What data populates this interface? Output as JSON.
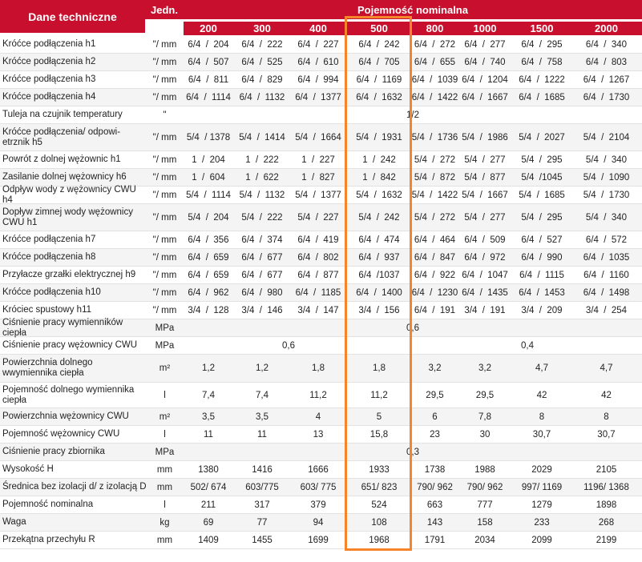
{
  "header": {
    "label": "Dane techniczne",
    "unit": "Jedn.",
    "group": "Pojemność nominalna",
    "capacities": [
      "200",
      "300",
      "400",
      "500",
      "800",
      "1000",
      "1500",
      "2000"
    ]
  },
  "rows": [
    {
      "label": "Króćce podłączenia h1",
      "unit": "\"/ mm",
      "values": [
        "6/4  /  204",
        "6/4  /  222",
        "6/4  /  227",
        "6/4  /  242",
        "6/4  /  272",
        "6/4  /  277",
        "6/4  /  295",
        "6/4  /  340"
      ]
    },
    {
      "label": "Króćce podłączenia h2",
      "unit": "\"/ mm",
      "values": [
        "6/4  /  507",
        "6/4  /  525",
        "6/4  /  610",
        "6/4  /  705",
        "6/4  /  655",
        "6/4  /  740",
        "6/4  /  758",
        "6/4  /  803"
      ]
    },
    {
      "label": "Króćce podłączenia h3",
      "unit": "\"/ mm",
      "values": [
        "6/4  /  811",
        "6/4  /  829",
        "6/4  /  994",
        "6/4  /  1169",
        "6/4  /  1039",
        "6/4  /  1204",
        "6/4  /  1222",
        "6/4  /  1267"
      ]
    },
    {
      "label": "Króćce podłączenia h4",
      "unit": "\"/ mm",
      "values": [
        "6/4  /  1114",
        "6/4  /  1132",
        "6/4  /  1377",
        "6/4  /  1632",
        "6/4  /  1422",
        "6/4  /  1667",
        "6/4  /  1685",
        "6/4  /  1730"
      ]
    },
    {
      "label": "Tuleja na czujnik temperatury",
      "unit": "\"",
      "span": "1/2"
    },
    {
      "label": "Króćce podłączenia/ odpowi-etrznik h5",
      "unit": "\"/ mm",
      "tall": true,
      "values": [
        "5/4  / 1378",
        "5/4  /  1414",
        "5/4  /  1664",
        "5/4  /  1931",
        "5/4  /  1736",
        "5/4  /  1986",
        "5/4  /  2027",
        "5/4  /  2104"
      ]
    },
    {
      "label": "Powrót z dolnej wężownic h1",
      "unit": "\"/ mm",
      "values": [
        "1  /  204",
        "1  /  222",
        "1  /  227",
        "1  /  242",
        "5/4  /  272",
        "5/4  /  277",
        "5/4  /  295",
        "5/4  /  340"
      ]
    },
    {
      "label": "Zasilanie dolnej wężownicy h6",
      "unit": "\"/ mm",
      "values": [
        "1  /  604",
        "1  /  622",
        "1  /  827",
        "1  /  842",
        "5/4  /  872",
        "5/4  /  877",
        "5/4  /1045",
        "5/4  /  1090"
      ]
    },
    {
      "label": "Odpływ wody z wężownicy CWU h4",
      "unit": "\"/ mm",
      "values": [
        "5/4  /  1114",
        "5/4  /  1132",
        "5/4  /  1377",
        "5/4  /  1632",
        "5/4  /  1422",
        "5/4  /  1667",
        "5/4  /  1685",
        "5/4  /  1730"
      ]
    },
    {
      "label": "Dopływ zimnej wody wężownicy CWU h1",
      "unit": "\"/ mm",
      "tall": true,
      "values": [
        "5/4  /  204",
        "5/4  /  222",
        "5/4  /  227",
        "5/4  /  242",
        "5/4  /  272",
        "5/4  /  277",
        "5/4  /  295",
        "5/4  /  340"
      ]
    },
    {
      "label": "Króćce podłączenia h7",
      "unit": "\"/ mm",
      "values": [
        "6/4  /  356",
        "6/4  /  374",
        "6/4  /  419",
        "6/4  /  474",
        "6/4  /  464",
        "6/4  /  509",
        "6/4  /  527",
        "6/4  /  572"
      ]
    },
    {
      "label": "Króćce podłączenia h8",
      "unit": "\"/ mm",
      "values": [
        "6/4  /  659",
        "6/4  /  677",
        "6/4  /  802",
        "6/4  /  937",
        "6/4  /  847",
        "6/4  /  972",
        "6/4  /  990",
        "6/4  /  1035"
      ]
    },
    {
      "label": "Przyłacze grzałki elektrycznej h9",
      "unit": "\"/ mm",
      "values": [
        "6/4  /  659",
        "6/4  /  677",
        "6/4  /  877",
        "6/4  /1037",
        "6/4  /  922",
        "6/4  /  1047",
        "6/4  /  1115",
        "6/4  /  1160"
      ]
    },
    {
      "label": "Króćce podłączenia h10",
      "unit": "\"/ mm",
      "values": [
        "6/4  /  962",
        "6/4  /  980",
        "6/4  /  1185",
        "6/4  /  1400",
        "6/4  /  1230",
        "6/4  /  1435",
        "6/4  /  1453",
        "6/4  /  1498"
      ]
    },
    {
      "label": "Króciec spustowy h11",
      "unit": "\"/ mm",
      "values": [
        "3/4  /  128",
        "3/4  /  146",
        "3/4  /  147",
        "3/4  /  156",
        "6/4  /  191",
        "3/4  /  191",
        "3/4  /  209",
        "3/4  /  254"
      ]
    },
    {
      "label": "Ciśnienie pracy wymienników ciepła",
      "unit": "MPa",
      "span": "0,6"
    },
    {
      "label": "Ciśnienie pracy wężownicy CWU",
      "unit": "MPa",
      "span_a": "0,6",
      "span_b": "0,4"
    },
    {
      "label": "Powierzchnia dolnego wwymiennika ciepła",
      "unit": "m²",
      "tall": true,
      "values": [
        "1,2",
        "1,2",
        "1,8",
        "1,8",
        "3,2",
        "3,2",
        "4,7",
        "4,7"
      ]
    },
    {
      "label": "Pojemność dolnego wymiennika ciepła",
      "unit": "l",
      "tall": true,
      "values": [
        "7,4",
        "7,4",
        "11,2",
        "11,2",
        "29,5",
        "29,5",
        "42",
        "42"
      ]
    },
    {
      "label": "Powierzchnia wężownicy CWU",
      "unit": "m²",
      "values": [
        "3,5",
        "3,5",
        "4",
        "5",
        "6",
        "7,8",
        "8",
        "8"
      ]
    },
    {
      "label": "Pojemność wężownicy CWU",
      "unit": "l",
      "values": [
        "11",
        "11",
        "13",
        "15,8",
        "23",
        "30",
        "30,7",
        "30,7"
      ]
    },
    {
      "label": "Ciśnienie pracy zbiornika",
      "unit": "MPa",
      "span": "0,3"
    },
    {
      "label": "Wysokość H",
      "unit": "mm",
      "values": [
        "1380",
        "1416",
        "1666",
        "1933",
        "1738",
        "1988",
        "2029",
        "2105"
      ]
    },
    {
      "label": "Średnica bez izolacji d/ z izolacją D",
      "unit": "mm",
      "values": [
        "502/ 674",
        "603/775",
        "603/ 775",
        "651/ 823",
        "790/ 962",
        "790/ 962",
        "997/ 1169",
        "1196/ 1368"
      ]
    },
    {
      "label": "Pojemność nominalna",
      "unit": "l",
      "values": [
        "211",
        "317",
        "379",
        "524",
        "663",
        "777",
        "1279",
        "1898"
      ]
    },
    {
      "label": "Waga",
      "unit": "kg",
      "values": [
        "69",
        "77",
        "94",
        "108",
        "143",
        "158",
        "233",
        "268"
      ]
    },
    {
      "label": "Przekątna przechyłu R",
      "unit": "mm",
      "values": [
        "1409",
        "1455",
        "1699",
        "1968",
        "1791",
        "2034",
        "2099",
        "2199"
      ]
    }
  ],
  "colors": {
    "header": "#c8102e",
    "highlight": "#f5842b",
    "row_alt": "#f4f4f4"
  }
}
